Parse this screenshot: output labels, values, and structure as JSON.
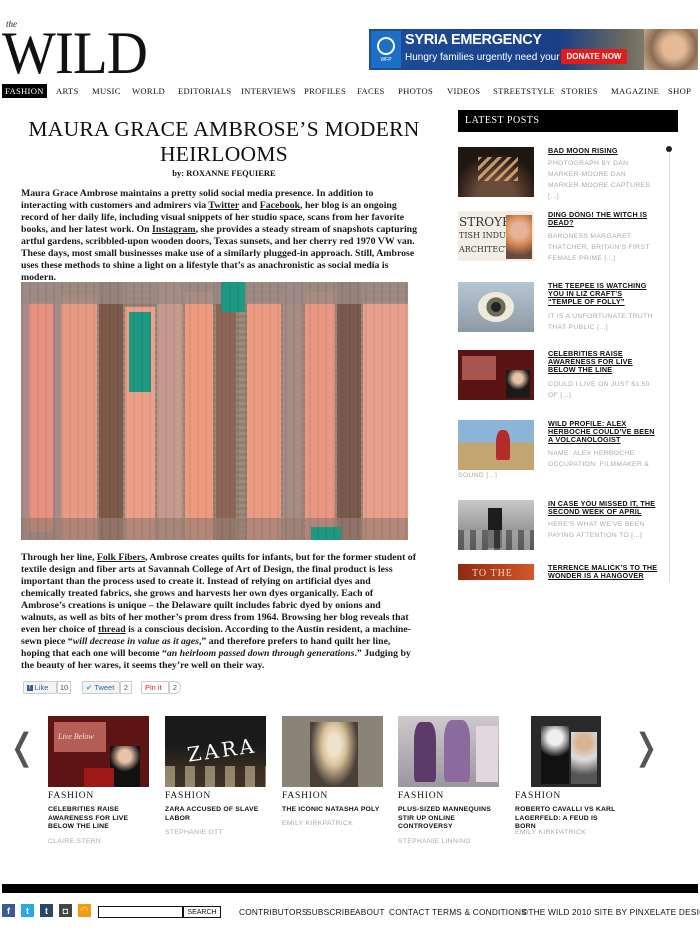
{
  "site": {
    "logo_the": "the",
    "logo_wild": "WILD"
  },
  "ad": {
    "logo_text": "WFP",
    "title": "SYRIA EMERGENCY",
    "subtitle": "Hungry families urgently need your help.",
    "button": "DONATE NOW"
  },
  "nav": [
    "FASHION",
    "ARTS",
    "MUSIC",
    "WORLD",
    "EDITORIALS",
    "INTERVIEWS",
    "PROFILES",
    "FACES",
    "PHOTOS",
    "VIDEOS",
    "STREETSTYLE",
    "STORIES",
    "MAGAZINE",
    "SHOP"
  ],
  "article": {
    "title_line1": "MAURA GRACE AMBROSE’S MODERN",
    "title_line2": "HEIRLOOMS",
    "byline": "by: ROXANNE FEQUIERE",
    "p1": {
      "a": "Maura Grace Ambrose maintains a pretty solid social media presence. In addition to interacting with customers and admirers via ",
      "link1": "Twitter",
      "b": " and ",
      "link2": "Facebook",
      "c": ", her blog is an ongoing record of her daily life, including visual snippets of her studio space, scans from her favorite books, and her latest work. On ",
      "link3": "Instagram",
      "d": ", she provides a steady stream of snapshots capturing artful gardens, scribbled-upon wooden doors, Texas sunsets, and her cherry red 1970 VW van. These days, most small businesses make use of a similarly plugged-in approach. Still, Ambrose uses these methods to shine a light on a lifestyle that’s as anachronistic as social media is modern."
    },
    "p2": {
      "a": "Through her line, ",
      "link1": "Folk Fibers",
      "b": ", Ambrose creates quilts for infants, but for the former student of textile design and fiber arts at Savannah College of Art of Design, the final product is less important than the process used to create it. Instead of relying on artificial dyes and chemically treated fabrics, she grows and harvests her own dyes organically. Each of Ambrose’s creations is unique – the Delaware quilt includes fabric dyed by onions and walnuts, as well as bits of her mother’s prom dress from 1964. Browsing her blog reveals that even her choice of ",
      "link2": "thread",
      "c": " is a conscious decision. According to the Austin resident, a machine-sewn piece “",
      "q1": "will decrease in value as it ages",
      "d": ",” and therefore prefers to hand quilt her line, hoping that each one will become “",
      "q2": "an heirloom passed down through generations",
      "e": ".” Judging by the beauty of her wares, it seems they’re well on their way."
    }
  },
  "share": {
    "like": "Like",
    "like_count": "10",
    "tweet": "Tweet",
    "tweet_count": "2",
    "pin": "Pin it",
    "pin_count": "2"
  },
  "sidebar": {
    "heading": "LATEST POSTS",
    "posts": [
      {
        "title": "BAD MOON RISING",
        "excerpt": "PHOTOGRAPH BY DAN MARKER-MOORE DAN MARKER-MOORE CAPTURES [...]"
      },
      {
        "title": "DING DONG! THE WITCH IS DEAD?",
        "excerpt": "BARONESS MARGARET THATCHER, BRITAIN’S FIRST FEMALE PRIME [...]"
      },
      {
        "title": "THE TEEPEE IS WATCHING YOU IN LIZ CRAFT’S “TEMPLE OF FOLLY”",
        "excerpt": "IT IS A UNFORTUNATE TRUTH THAT PUBLIC [...]"
      },
      {
        "title": "CELEBRITIES RAISE AWARENESS FOR LIVE BELOW THE LINE",
        "excerpt": "COULD I LIVE ON JUST $1.50 OF [...]"
      },
      {
        "title": "WILD PROFILE: ALEX HERBOCHE COULD’VE BEEN A VOLCANOLOGIST",
        "excerpt_a": "NAME: ALEX HERBOCHE OCCUPATION: FILMMAKER &",
        "excerpt_b": "SOUND [...]"
      },
      {
        "title": "IN CASE YOU MISSED IT, THE SECOND WEEK OF APRIL",
        "excerpt": "HERE’S WHAT WE’VE BEEN PAYING ATTENTION TO [...]"
      },
      {
        "title": "TERRENCE MALICK’S TO THE WONDER IS A HANGOVER",
        "thumb_text": "TO THE"
      }
    ]
  },
  "carousel": [
    {
      "cat": "FASHION",
      "title": "CELEBRITIES RAISE AWARENESS FOR LIVE BELOW THE LINE",
      "author": "CLAIRE STERN",
      "img_text": "Live Below"
    },
    {
      "cat": "FASHION",
      "title": "ZARA ACCUSED OF SLAVE LABOR",
      "author": "STEPHANIE OTT",
      "img_text": "ZARA"
    },
    {
      "cat": "FASHION",
      "title": "THE ICONIC NATASHA POLY",
      "author": "EMILY KIRKPATRICK"
    },
    {
      "cat": "FASHION",
      "title": "PLUS-SIZED MANNEQUINS STIR UP ONLINE CONTROVERSY",
      "author": "STEPHANIE LINNING"
    },
    {
      "cat": "FASHION",
      "title": "ROBERTO CAVALLI VS KARL LAGERFELD: A FEUD IS BORN",
      "author": "EMILY KIRKPATRICK"
    }
  ],
  "footer": {
    "search_button": "SEARCH",
    "links": [
      "CONTRIBUTORS",
      "SUBSCRIBE",
      "ABOUT",
      "CONTACT",
      "TERMS & CONDITIONS",
      "©THE WILD 2010",
      "SITE BY PINXELATE DESIGN"
    ]
  },
  "colors": {
    "ad_blue": "#1e4d9a",
    "ad_red": "#e41b1b",
    "black": "#000000",
    "facebook": "#3b5998",
    "twitter": "#1da1f2",
    "pinterest": "#cb2027"
  }
}
